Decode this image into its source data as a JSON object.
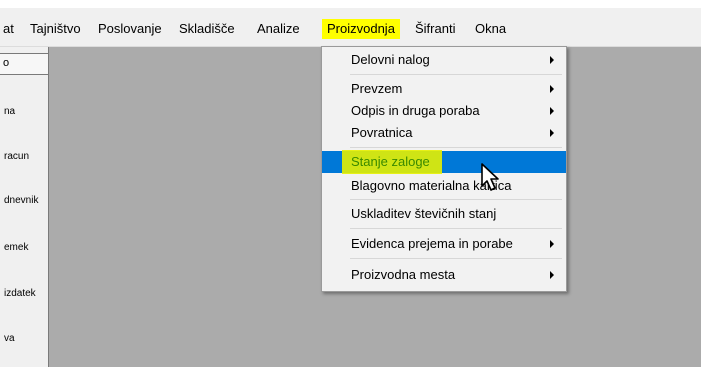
{
  "menubar": {
    "items": [
      {
        "label": "at",
        "highlight": false
      },
      {
        "label": "Tajništvo",
        "highlight": false
      },
      {
        "label": "Poslovanje",
        "highlight": false
      },
      {
        "label": "Skladišče",
        "highlight": false
      },
      {
        "label": "Analize",
        "highlight": false
      },
      {
        "label": "Proizvodnja",
        "highlight": true
      },
      {
        "label": "Šifranti",
        "highlight": false
      },
      {
        "label": "Okna",
        "highlight": false
      }
    ]
  },
  "sidebar": {
    "header": "o",
    "items": [
      "na",
      "racun",
      "dnevnik",
      "emek",
      "izdatek",
      "va"
    ]
  },
  "dropdown": {
    "items": [
      {
        "label": "Delovni nalog",
        "submenu": true
      },
      {
        "label": "Prevzem",
        "submenu": true
      },
      {
        "label": "Odpis in druga poraba",
        "submenu": true
      },
      {
        "label": "Povratnica",
        "submenu": true
      },
      {
        "label": "Stanje zaloge",
        "submenu": false,
        "selected": true
      },
      {
        "label": "Blagovno materialna kartica",
        "submenu": false
      },
      {
        "label": "Uskladitev števičnih stanj",
        "submenu": false
      },
      {
        "label": "Evidenca prejema in porabe",
        "submenu": true
      },
      {
        "label": "Proizvodna mesta",
        "submenu": true
      }
    ]
  },
  "colors": {
    "menu_highlight": "#ffff00",
    "selection": "#0078d7",
    "annotation_highlight": "#e6f000",
    "workspace": "#ababab"
  }
}
